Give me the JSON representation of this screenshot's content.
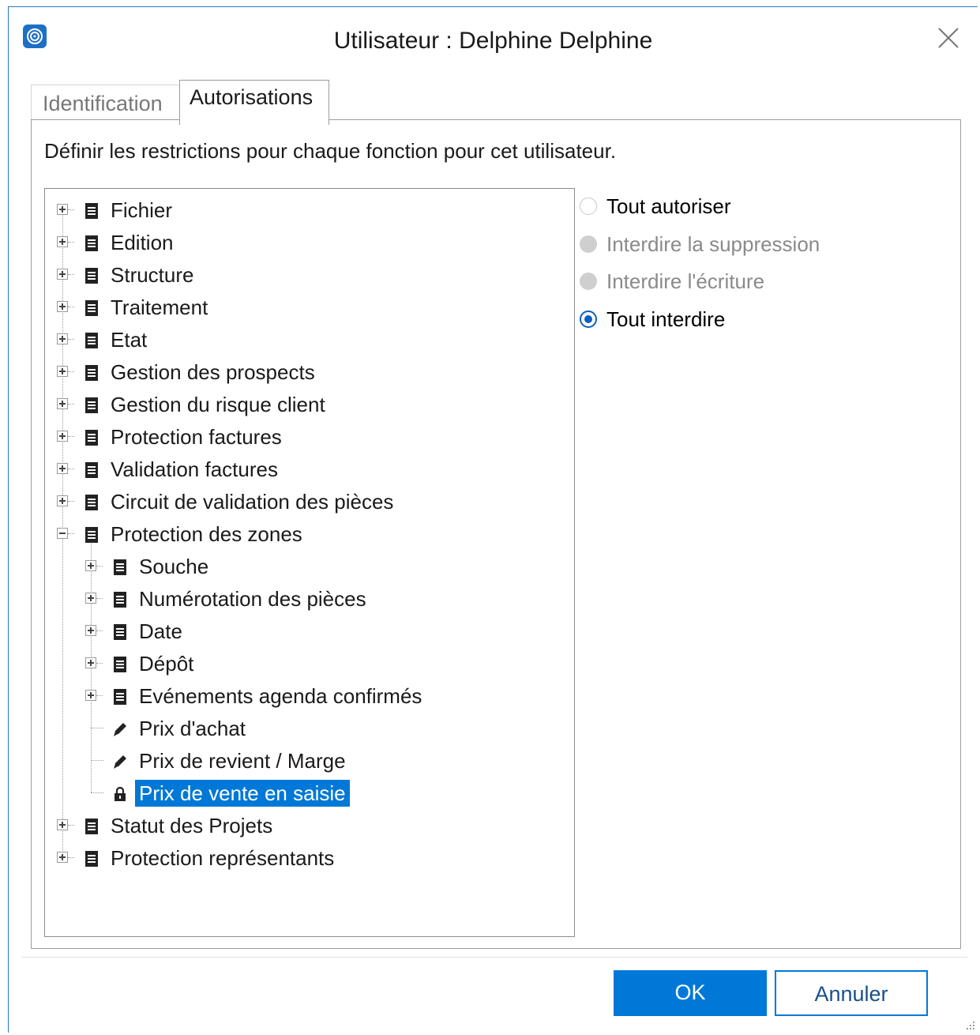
{
  "window": {
    "title": "Utilisateur : Delphine Delphine"
  },
  "tabs": [
    {
      "label": "Identification",
      "active": false
    },
    {
      "label": "Autorisations",
      "active": true
    }
  ],
  "instructions": "Définir les restrictions pour chaque fonction pour cet utilisateur.",
  "tree": {
    "items": [
      {
        "label": "Fichier",
        "level": 0,
        "expander": "plus",
        "icon": "document-icon"
      },
      {
        "label": "Edition",
        "level": 0,
        "expander": "plus",
        "icon": "document-icon"
      },
      {
        "label": "Structure",
        "level": 0,
        "expander": "plus",
        "icon": "document-icon"
      },
      {
        "label": "Traitement",
        "level": 0,
        "expander": "plus",
        "icon": "document-icon"
      },
      {
        "label": "Etat",
        "level": 0,
        "expander": "plus",
        "icon": "document-icon"
      },
      {
        "label": "Gestion des prospects",
        "level": 0,
        "expander": "plus",
        "icon": "document-icon"
      },
      {
        "label": "Gestion du risque client",
        "level": 0,
        "expander": "plus",
        "icon": "document-icon"
      },
      {
        "label": "Protection factures",
        "level": 0,
        "expander": "plus",
        "icon": "document-icon"
      },
      {
        "label": "Validation factures",
        "level": 0,
        "expander": "plus",
        "icon": "document-icon"
      },
      {
        "label": "Circuit de validation des pièces",
        "level": 0,
        "expander": "plus",
        "icon": "document-icon"
      },
      {
        "label": "Protection des zones",
        "level": 0,
        "expander": "minus",
        "icon": "document-icon"
      },
      {
        "label": "Souche",
        "level": 1,
        "expander": "plus",
        "icon": "document-icon"
      },
      {
        "label": "Numérotation des pièces",
        "level": 1,
        "expander": "plus",
        "icon": "document-icon"
      },
      {
        "label": "Date",
        "level": 1,
        "expander": "plus",
        "icon": "document-icon"
      },
      {
        "label": "Dépôt",
        "level": 1,
        "expander": "plus",
        "icon": "document-icon"
      },
      {
        "label": "Evénements agenda confirmés",
        "level": 1,
        "expander": "plus",
        "icon": "document-icon"
      },
      {
        "label": "Prix d'achat",
        "level": 1,
        "expander": "none",
        "icon": "pencil-icon"
      },
      {
        "label": "Prix de revient / Marge",
        "level": 1,
        "expander": "none",
        "icon": "pencil-icon"
      },
      {
        "label": "Prix de vente en saisie",
        "level": 1,
        "expander": "none",
        "icon": "lock-icon",
        "selected": true
      },
      {
        "label": "Statut des Projets",
        "level": 0,
        "expander": "plus",
        "icon": "document-icon"
      },
      {
        "label": "Protection représentants",
        "level": 0,
        "expander": "plus",
        "icon": "document-icon"
      }
    ]
  },
  "options": [
    {
      "label": "Tout autoriser",
      "state": "empty",
      "enabled": true
    },
    {
      "label": "Interdire la suppression",
      "state": "disabled",
      "enabled": false
    },
    {
      "label": "Interdire l'écriture",
      "state": "disabled",
      "enabled": false
    },
    {
      "label": "Tout interdire",
      "state": "checked",
      "enabled": true
    }
  ],
  "buttons": {
    "ok": "OK",
    "cancel": "Annuler"
  },
  "colors": {
    "accent": "#0078d7",
    "selection": "#0078d7"
  }
}
